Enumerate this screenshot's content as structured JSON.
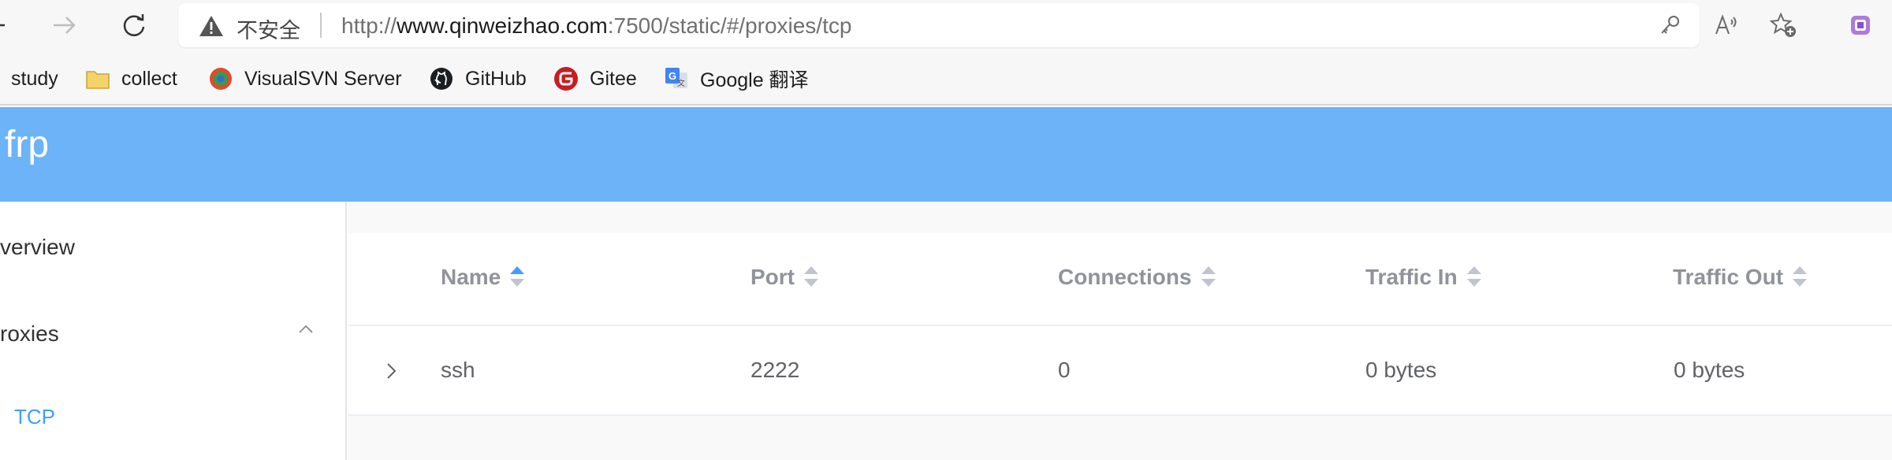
{
  "browser": {
    "security_label": "不安全",
    "url_scheme": "http://",
    "url_host": "www.qinweizhao.com",
    "url_rest": ":7500/static/#/proxies/tcp",
    "bookmarks": [
      {
        "label": "study",
        "icon": "none"
      },
      {
        "label": "collect",
        "icon": "folder-icon"
      },
      {
        "label": "VisualSVN Server",
        "icon": "visualsvn-icon"
      },
      {
        "label": "GitHub",
        "icon": "github-icon"
      },
      {
        "label": "Gitee",
        "icon": "gitee-icon"
      },
      {
        "label": "Google 翻译",
        "icon": "google-translate-icon"
      }
    ]
  },
  "app": {
    "brand": "frp",
    "header_color": "#6db3f8",
    "accent_color": "#409eff"
  },
  "sidebar": {
    "overview_label": "verview",
    "proxies_label": "roxies",
    "tcp_label": "TCP"
  },
  "table": {
    "headers": {
      "name": "Name",
      "port": "Port",
      "connections": "Connections",
      "traffic_in": "Traffic In",
      "traffic_out": "Traffic Out"
    },
    "sorted_column": "name",
    "rows": [
      {
        "name": "ssh",
        "port": "2222",
        "connections": "0",
        "traffic_in": "0 bytes",
        "traffic_out": "0 bytes"
      }
    ]
  }
}
